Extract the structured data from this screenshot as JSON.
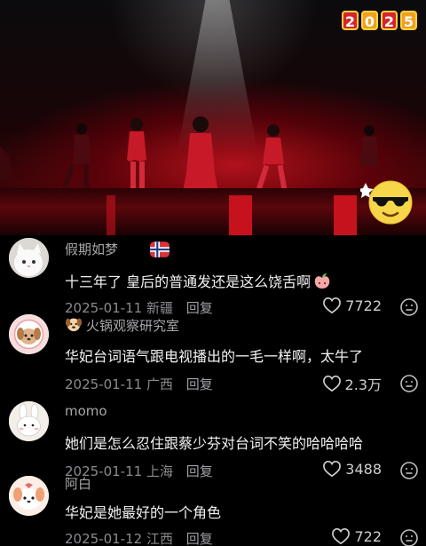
{
  "video": {
    "year_badge": [
      "2",
      "0",
      "2",
      "5"
    ]
  },
  "comments": [
    {
      "username": "假期如梦",
      "text": "十三年了 皇后的普通发还是这么饶舌啊",
      "date": "2025-01-11",
      "location": "新疆",
      "reply_label": "回复",
      "likes": "7722"
    },
    {
      "username": "火锅观察研究室",
      "text": "华妃台词语气跟电视播出的一毛一样啊，太牛了",
      "date": "2025-01-11",
      "location": "广西",
      "reply_label": "回复",
      "likes": "2.3万"
    },
    {
      "username": "momo",
      "text": "她们是怎么忍住跟蔡少芬对台词不笑的哈哈哈哈",
      "date": "2025-01-11",
      "location": "上海",
      "reply_label": "回复",
      "likes": "3488"
    },
    {
      "username": "阿白",
      "text": "华妃是她最好的一个角色",
      "date": "2025-01-12",
      "location": "江西",
      "reply_label": "回复",
      "likes": "722"
    }
  ]
}
